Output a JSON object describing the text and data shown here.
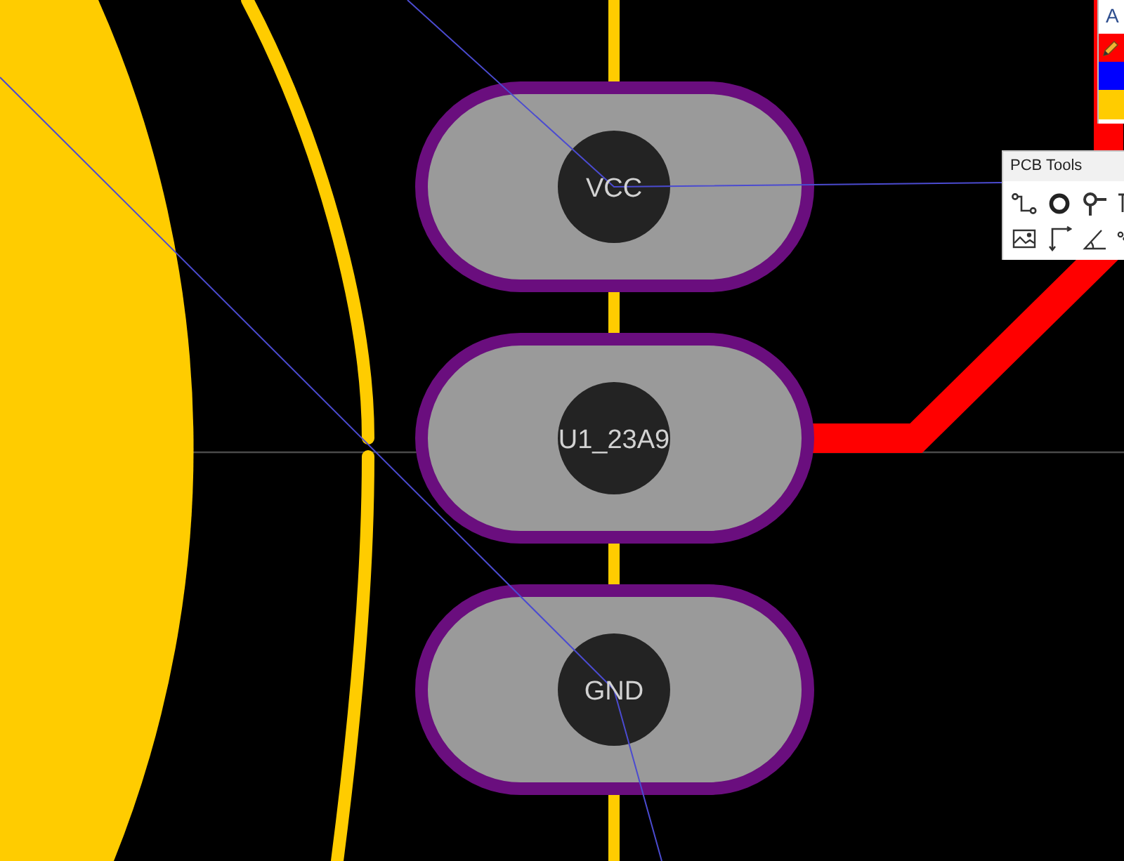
{
  "layers_panel": {
    "header": "A",
    "layers": [
      {
        "color": "#ff0000",
        "selected": true
      },
      {
        "color": "#0000ff",
        "selected": false
      },
      {
        "color": "#ffcc00",
        "selected": false
      }
    ]
  },
  "pads": [
    {
      "label": "VCC"
    },
    {
      "label": "U1_23A9"
    },
    {
      "label": "GND"
    }
  ],
  "pcb_tools": {
    "title": "PCB Tools"
  }
}
